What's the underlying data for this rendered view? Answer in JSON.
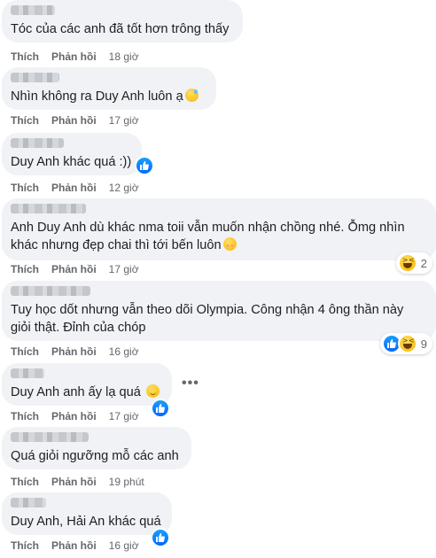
{
  "comments": [
    {
      "text": "Tóc của các anh đã tốt hơn trông thấy",
      "like": "Thích",
      "reply": "Phản hồi",
      "time": "18 giờ"
    },
    {
      "text": "Nhìn không ra Duy Anh luôn ạ",
      "emoji": "sweat-smile-emoji",
      "like": "Thích",
      "reply": "Phản hồi",
      "time": "17 giờ"
    },
    {
      "text": "Duy Anh khác quá :))",
      "like": "Thích",
      "reply": "Phản hồi",
      "time": "12 giờ",
      "inline_reaction": "like"
    },
    {
      "text": "Anh Duy Anh dù khác nma toii vẫn muốn nhận chồng nhé. Ỗmg nhìn\nkhác nhưng đẹp chai thì tới bến luôn",
      "emoji": "blush-emoji",
      "like": "Thích",
      "reply": "Phản hồi",
      "time": "17 giờ",
      "reaction_count": "2",
      "reactions": [
        "haha"
      ]
    },
    {
      "text": "Tuy học dốt nhưng vẫn theo dõi Olympia. Công nhận 4 ông thần này\ngiỏi thật. Đỉnh của chóp",
      "like": "Thích",
      "reply": "Phản hồi",
      "time": "16 giờ",
      "reaction_count": "9",
      "reactions": [
        "like",
        "haha"
      ]
    },
    {
      "text": "Duy Anh anh ấy lạ quá",
      "emoji": "smile-emoji",
      "like": "Thích",
      "reply": "Phản hồi",
      "time": "17 giờ",
      "inline_reaction": "like",
      "more": "•••"
    },
    {
      "text": "Quá giỏi ngưỡng mỗ các anh",
      "like": "Thích",
      "reply": "Phản hồi",
      "time": "19 phút"
    },
    {
      "text": "Duy Anh, Hải An khác quá",
      "like": "Thích",
      "reply": "Phản hồi",
      "time": "16 giờ",
      "inline_reaction": "like"
    }
  ],
  "colors": {
    "bubble": "#f0f2f5",
    "text": "#1c1e21",
    "meta": "#65676b",
    "like_blue": "#0866ff"
  }
}
